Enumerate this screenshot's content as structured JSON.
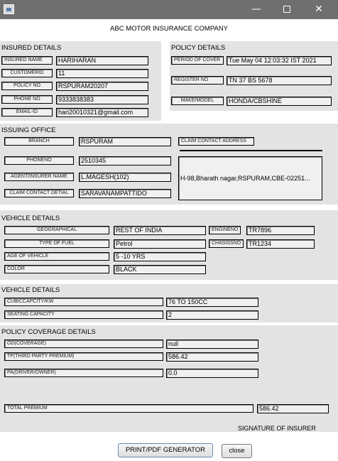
{
  "window": {
    "minimize": "—",
    "close": "✕"
  },
  "company": "ABC MOTOR INSURANCE COMPANY",
  "insured": {
    "title": "INSURED DETAILS",
    "name_label": "INSURED NAME",
    "name": "HARIHARAN",
    "customerid_label": "CUSTOMERID",
    "customerid": "11",
    "policyno_label": "POLICY NO",
    "policyno": "RSPURAM20207",
    "phone_label": "PHONE NO",
    "phone": "9333838383",
    "email_label": "EMAIL-ID",
    "email": "hari20010321@gmail.com"
  },
  "policy": {
    "title": "POLICY DETAILS",
    "period_label": "PERIOD OF COVER",
    "period": "Tue May 04 12:03:32 IST 2021",
    "register_label": "REGISTER NO",
    "register": "TN 37 BS 5678",
    "make_label": "MAKE/MODEL",
    "make": "HONDA/CBSHINE"
  },
  "issuing": {
    "title": "ISSUING OFFICE",
    "branch_label": "BRANCH",
    "branch": "RSPURAM",
    "phoneno_label": "PHONENO",
    "phoneno": "2510345",
    "agent_label": "AGENT/INSURER NAME",
    "agent": "L.MAGESH(102)",
    "claim_detail_label": "CLAIM CONTACT DETIAL",
    "claim_detail": "SARAVANAMPATTIDO",
    "claim_address_label": "CLAIM CONTACT ADDRESS",
    "claim_address": "H-98,Bharath nagar,RSPURAM,CBE-02251..."
  },
  "vehicle1": {
    "title": "VEHICLE DETAILS",
    "geo_label": "GEOGRAPHICAL",
    "geo": "REST OF INDIA",
    "fuel_label": "TYPE OF FUEL",
    "fuel": "Petrol",
    "age_label": "AGE OF VEHICLE",
    "age": "5 -10 YRS",
    "color_label": "COLOR",
    "color": "BLACK",
    "engine_label": "ENGINENO",
    "engine": "TR7896",
    "chassis_label": "CHASISSNO",
    "chassis": "TR1234"
  },
  "vehicle2": {
    "title": "VEHICLE DETAILS",
    "cc_label": "CUBICCAPCITY/KW",
    "cc": "76 TO 150CC",
    "seat_label": "SEATING CAPACITY",
    "seat": "2"
  },
  "coverage": {
    "title": "POLICY COVERAGE DETAILS",
    "od_label": "OD(COVERAGE)",
    "od": "null",
    "tp_label": "TP(THIRD PARTY PREMIUM)",
    "tp": "586.42",
    "pa_label": "PA(DRIVER/OWNER)",
    "pa": "0.0",
    "total_label": "TOTAL PREMIUM",
    "total": "586.42"
  },
  "signature": "SIGNATURE OF INSURER",
  "buttons": {
    "print": "PRINT/PDF GENERATOR",
    "close": "close"
  }
}
